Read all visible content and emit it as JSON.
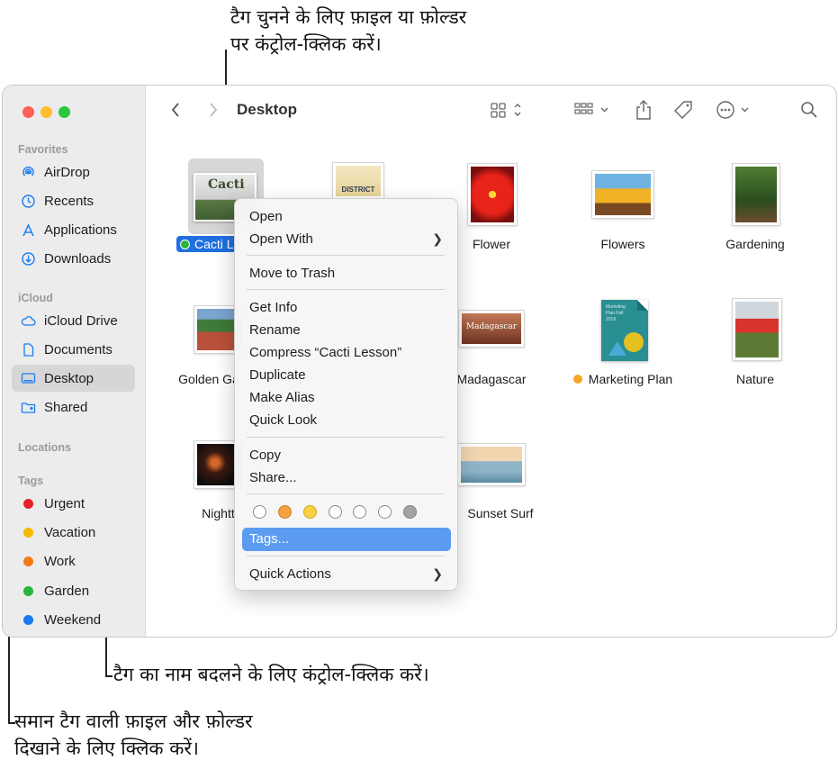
{
  "callouts": {
    "top_line1": "टैग चुनने के लिए फ़ाइल या फ़ोल्डर",
    "top_line2": "पर कंट्रोल-क्लिक करें।",
    "rename": "टैग का नाम बदलने के लिए कंट्रोल-क्लिक करें।",
    "show_line1": "समान टैग वाली फ़ाइल और फ़ोल्डर",
    "show_line2": "दिखाने के लिए क्लिक करें।"
  },
  "sidebar": {
    "favorites_header": "Favorites",
    "favorites": [
      {
        "label": "AirDrop",
        "icon": "airdrop-icon"
      },
      {
        "label": "Recents",
        "icon": "clock-icon"
      },
      {
        "label": "Applications",
        "icon": "applications-icon"
      },
      {
        "label": "Downloads",
        "icon": "download-icon"
      }
    ],
    "icloud_header": "iCloud",
    "icloud": [
      {
        "label": "iCloud Drive",
        "icon": "cloud-icon"
      },
      {
        "label": "Documents",
        "icon": "document-icon"
      },
      {
        "label": "Desktop",
        "icon": "desktop-icon",
        "selected": true
      },
      {
        "label": "Shared",
        "icon": "shared-folder-icon"
      }
    ],
    "locations_header": "Locations",
    "tags_header": "Tags",
    "tags": [
      {
        "label": "Urgent",
        "color": "#e8202a"
      },
      {
        "label": "Vacation",
        "color": "#f5b800"
      },
      {
        "label": "Work",
        "color": "#f07a16"
      },
      {
        "label": "Garden",
        "color": "#28b63a"
      },
      {
        "label": "Weekend",
        "color": "#1878f0"
      }
    ]
  },
  "toolbar": {
    "title": "Desktop",
    "icons": [
      "back-icon",
      "forward-icon",
      "grid-view-icon",
      "group-icon",
      "share-icon",
      "tag-icon",
      "more-icon",
      "search-icon"
    ]
  },
  "files": [
    {
      "name": "Cacti L",
      "selected": true,
      "tag_color": "#28b63a",
      "thumb_text": "Cacti"
    },
    {
      "name": "",
      "thumb_text": "DISTRICT"
    },
    {
      "name": "Flower"
    },
    {
      "name": "Flowers"
    },
    {
      "name": "Gardening"
    },
    {
      "name": "Golden Ga"
    },
    {
      "name": "Madagascar",
      "thumb_text": "Madagascar"
    },
    {
      "name": "Marketing Plan",
      "tag_color": "#f5a623",
      "thumb_text": "Marketing Plan Fall 2019"
    },
    {
      "name": "Nature"
    },
    {
      "name": "Nightti"
    },
    {
      "name": "Sunset Surf"
    }
  ],
  "context_menu": {
    "items": [
      {
        "label": "Open"
      },
      {
        "label": "Open With",
        "submenu": true
      },
      {
        "label": "Move to Trash"
      },
      {
        "label": "Get Info"
      },
      {
        "label": "Rename"
      },
      {
        "label": "Compress “Cacti Lesson”"
      },
      {
        "label": "Duplicate"
      },
      {
        "label": "Make Alias"
      },
      {
        "label": "Quick Look"
      },
      {
        "label": "Copy"
      },
      {
        "label": "Share..."
      },
      {
        "label": "Tags...",
        "highlighted": true
      },
      {
        "label": "Quick Actions",
        "submenu": true
      }
    ],
    "tag_colors": [
      "#ffffff",
      "#f5a142",
      "#f7d043",
      "#ffffff",
      "#ffffff",
      "#ffffff",
      "#a4a4a4"
    ]
  }
}
